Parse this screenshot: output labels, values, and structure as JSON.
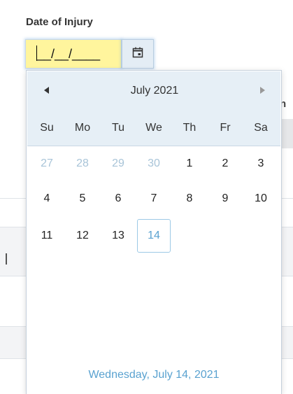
{
  "form": {
    "field_label": "Date of Injury",
    "date_value": "/__/____",
    "date_leading": "__",
    "calendar_button_icon": "calendar-icon"
  },
  "background": {
    "header_fragment": "n"
  },
  "calendar": {
    "month_title": "July 2021",
    "prev_icon": "triangle-left-icon",
    "next_icon": "triangle-right-icon",
    "weekdays": [
      "Su",
      "Mo",
      "Tu",
      "We",
      "Th",
      "Fr",
      "Sa"
    ],
    "weeks": [
      [
        "27",
        "28",
        "29",
        "30",
        "1",
        "2",
        "3"
      ],
      [
        "4",
        "5",
        "6",
        "7",
        "8",
        "9",
        "10"
      ],
      [
        "11",
        "12",
        "13",
        "14"
      ]
    ],
    "other_month_days": [
      "27",
      "28",
      "29",
      "30"
    ],
    "today": "14",
    "footer": "Wednesday, July 14, 2021",
    "colors": {
      "header_bg": "#e6eff6",
      "today_accent": "#5aa2d0",
      "other_month": "#a8c4d8",
      "input_highlight": "#fff59d"
    }
  }
}
